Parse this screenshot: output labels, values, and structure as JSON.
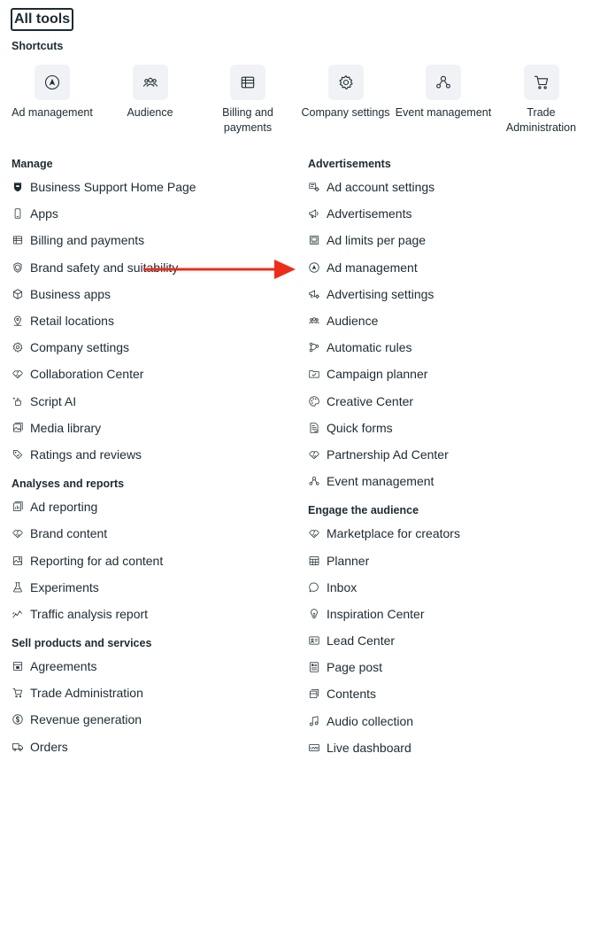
{
  "page": {
    "title": "All tools"
  },
  "shortcuts": {
    "heading": "Shortcuts",
    "items": [
      {
        "label": "Ad management",
        "icon": "ad-management-icon"
      },
      {
        "label": "Audience",
        "icon": "audience-icon"
      },
      {
        "label": "Billing and payments",
        "icon": "billing-icon"
      },
      {
        "label": "Company settings",
        "icon": "gear-icon"
      },
      {
        "label": "Event management",
        "icon": "event-management-icon"
      },
      {
        "label": "Trade Administration",
        "icon": "cart-icon"
      }
    ]
  },
  "left": {
    "manage": {
      "heading": "Manage",
      "items": [
        {
          "label": "Business Support Home Page",
          "icon": "shield-badge-icon"
        },
        {
          "label": "Apps",
          "icon": "phone-icon"
        },
        {
          "label": "Billing and payments",
          "icon": "billing-icon"
        },
        {
          "label": "Brand safety and suitability",
          "icon": "shield-icon"
        },
        {
          "label": "Business apps",
          "icon": "cube-icon"
        },
        {
          "label": "Retail locations",
          "icon": "location-pin-icon"
        },
        {
          "label": "Company settings",
          "icon": "gear-icon"
        },
        {
          "label": "Collaboration Center",
          "icon": "handshake-icon"
        },
        {
          "label": "Script AI",
          "icon": "sparkle-hand-icon"
        },
        {
          "label": "Media library",
          "icon": "media-icon"
        },
        {
          "label": "Ratings and reviews",
          "icon": "tag-icon"
        }
      ]
    },
    "analyses": {
      "heading": "Analyses and reports",
      "items": [
        {
          "label": "Ad reporting",
          "icon": "report-icon"
        },
        {
          "label": "Brand content",
          "icon": "handshake-icon"
        },
        {
          "label": "Reporting for ad content",
          "icon": "image-chart-icon"
        },
        {
          "label": "Experiments",
          "icon": "flask-icon"
        },
        {
          "label": "Traffic analysis report",
          "icon": "trend-icon"
        }
      ]
    },
    "sell": {
      "heading": "Sell products and services",
      "items": [
        {
          "label": "Agreements",
          "icon": "storefront-icon"
        },
        {
          "label": "Trade Administration",
          "icon": "cart-icon"
        },
        {
          "label": "Revenue generation",
          "icon": "dollar-icon"
        },
        {
          "label": "Orders",
          "icon": "truck-icon"
        }
      ]
    }
  },
  "right": {
    "ads": {
      "heading": "Advertisements",
      "items": [
        {
          "label": "Ad account settings",
          "icon": "ad-settings-icon"
        },
        {
          "label": "Advertisements",
          "icon": "megaphone-icon"
        },
        {
          "label": "Ad limits per page",
          "icon": "page-limit-icon"
        },
        {
          "label": "Ad management",
          "icon": "ad-management-icon"
        },
        {
          "label": "Advertising settings",
          "icon": "megaphone-gear-icon"
        },
        {
          "label": "Audience",
          "icon": "audience-icon"
        },
        {
          "label": "Automatic rules",
          "icon": "rules-icon"
        },
        {
          "label": "Campaign planner",
          "icon": "folder-check-icon"
        },
        {
          "label": "Creative Center",
          "icon": "palette-icon"
        },
        {
          "label": "Quick forms",
          "icon": "form-icon"
        },
        {
          "label": "Partnership Ad Center",
          "icon": "handshake-icon"
        },
        {
          "label": "Event management",
          "icon": "event-management-icon"
        }
      ]
    },
    "engage": {
      "heading": "Engage the audience",
      "items": [
        {
          "label": "Marketplace for creators",
          "icon": "handshake-icon"
        },
        {
          "label": "Planner",
          "icon": "calendar-grid-icon"
        },
        {
          "label": "Inbox",
          "icon": "chat-bubble-icon"
        },
        {
          "label": "Inspiration Center",
          "icon": "lightbulb-icon"
        },
        {
          "label": "Lead Center",
          "icon": "id-card-icon"
        },
        {
          "label": "Page post",
          "icon": "post-icon"
        },
        {
          "label": "Contents",
          "icon": "stack-icon"
        },
        {
          "label": "Audio collection",
          "icon": "music-note-icon"
        },
        {
          "label": "Live dashboard",
          "icon": "live-icon"
        }
      ]
    }
  },
  "annotation": {
    "color": "#ee2c1a"
  }
}
